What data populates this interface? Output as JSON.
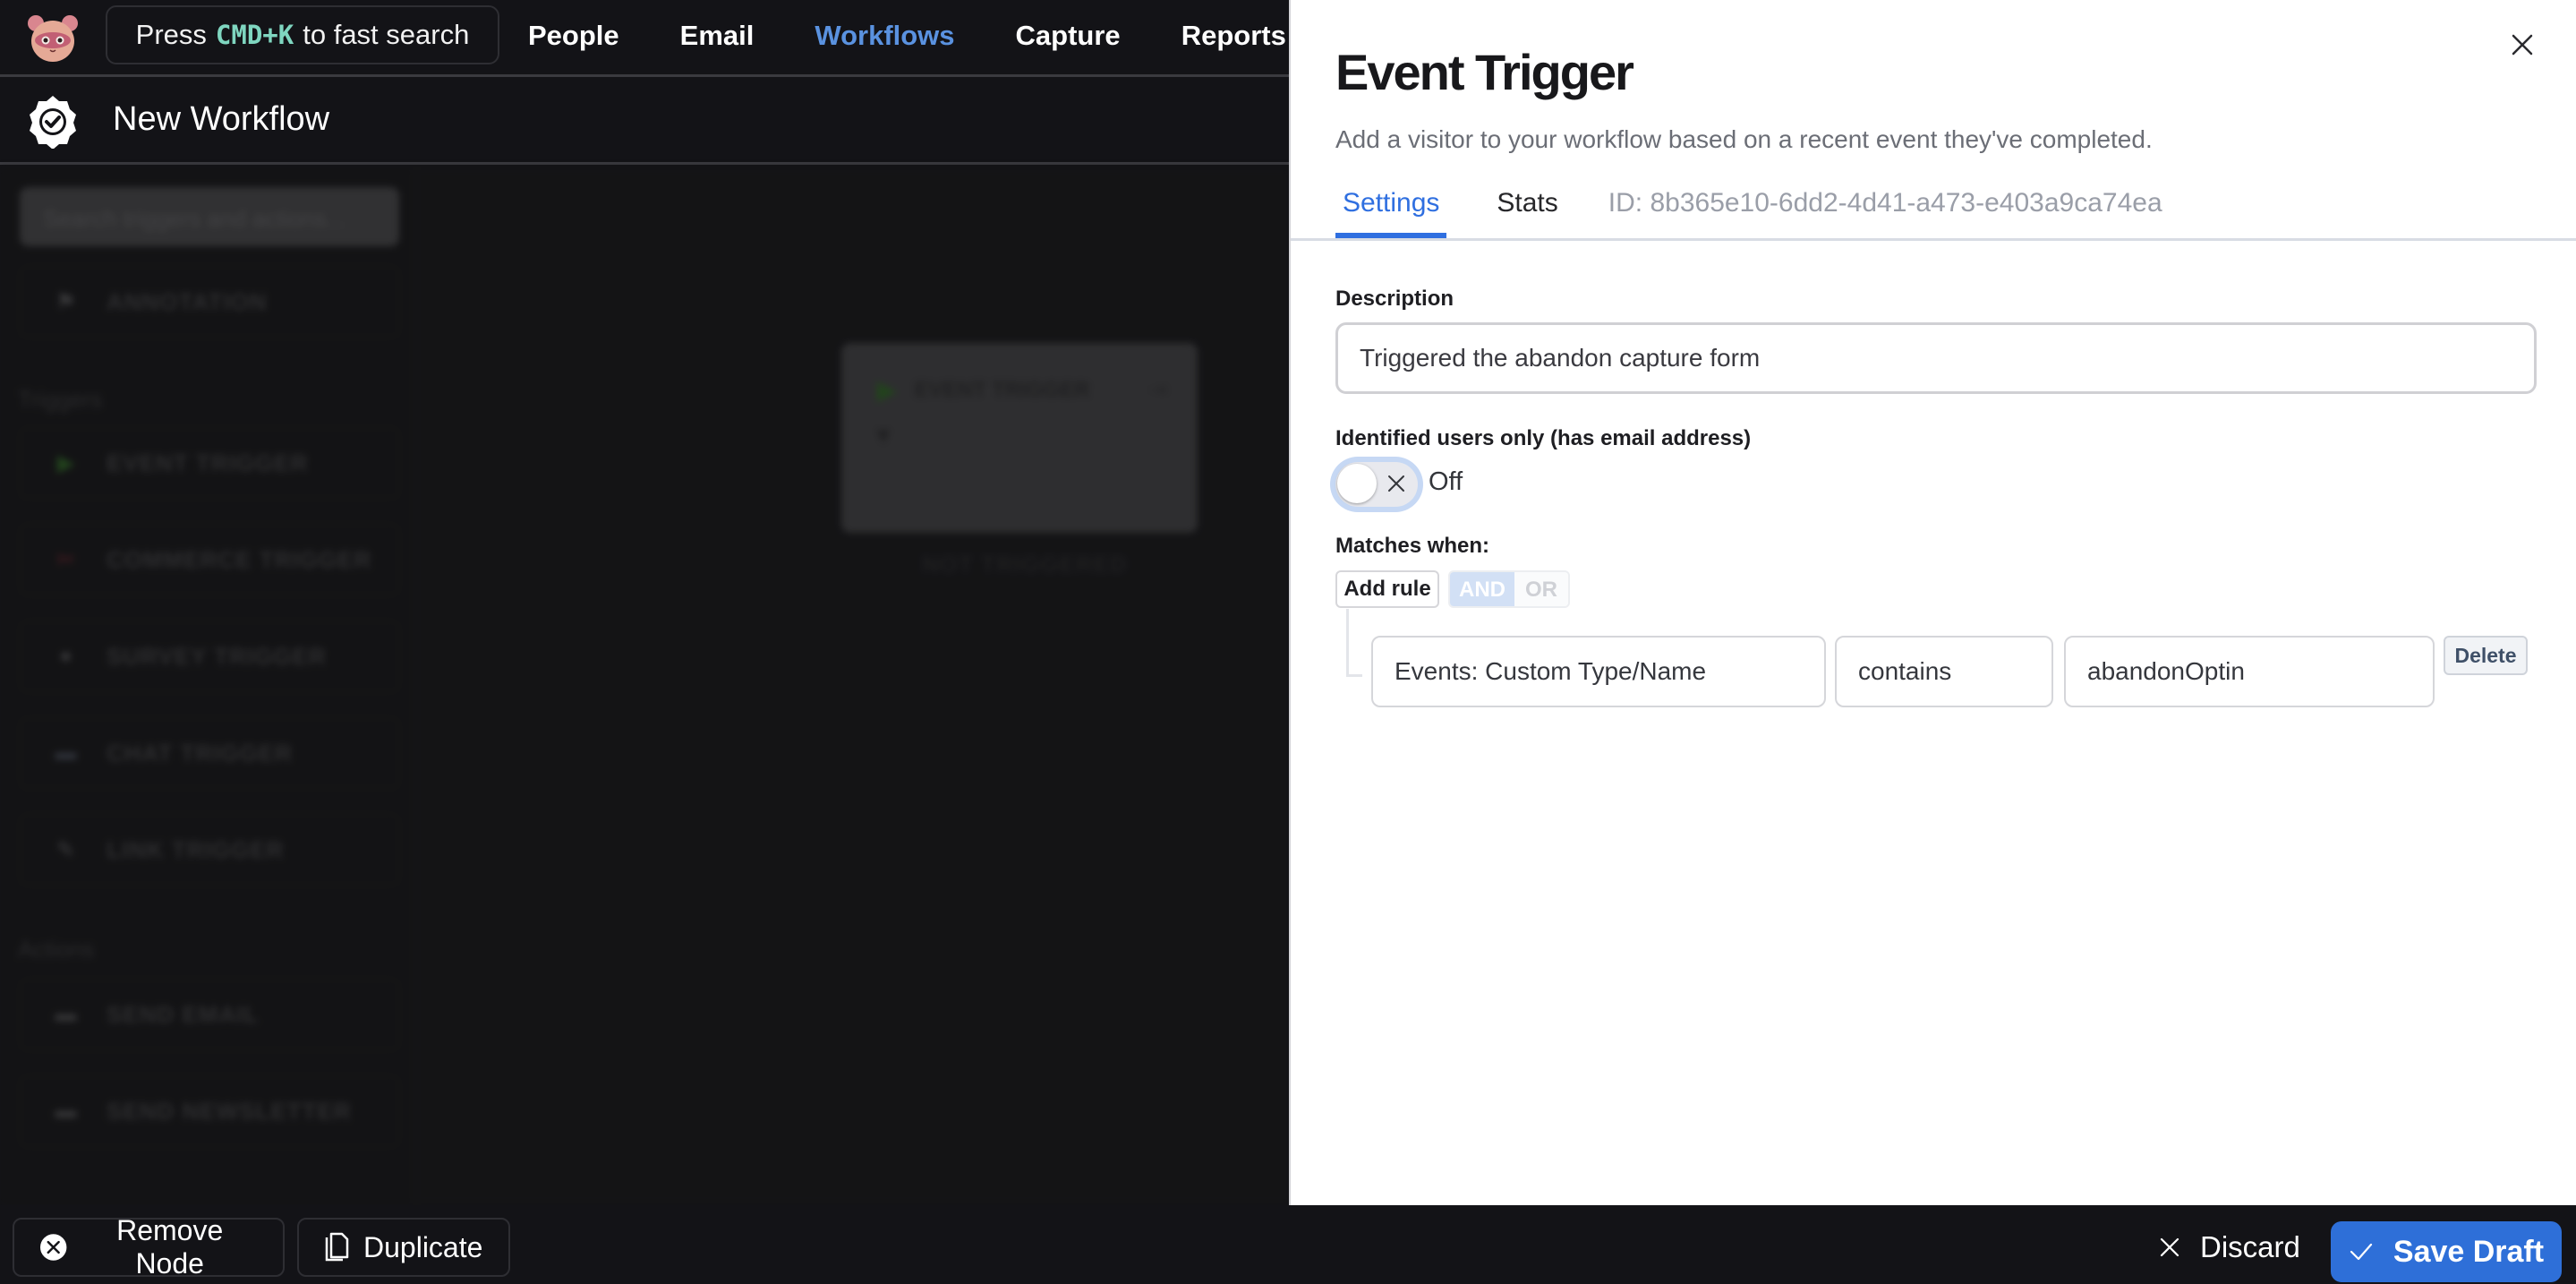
{
  "topnav": {
    "search_prefix": "Press",
    "search_shortcut": "CMD+K",
    "search_suffix": "to fast search",
    "items": [
      {
        "label": "People",
        "active": false
      },
      {
        "label": "Email",
        "active": false
      },
      {
        "label": "Workflows",
        "active": true
      },
      {
        "label": "Capture",
        "active": false
      },
      {
        "label": "Reports",
        "active": false
      }
    ],
    "accent_color": "#5a92e0",
    "shortcut_color": "#7fd6c0"
  },
  "workflow": {
    "title": "New Workflow"
  },
  "sidebar": {
    "search_placeholder": "Search triggers and actions...",
    "annotation_item": {
      "label": "ANNOTATION",
      "icon": "flag-icon"
    },
    "triggers_heading": "Triggers",
    "triggers": [
      {
        "label": "EVENT TRIGGER",
        "icon": "play-icon"
      },
      {
        "label": "COMMERCE TRIGGER",
        "icon": "cart-icon"
      },
      {
        "label": "SURVEY TRIGGER",
        "icon": "person-icon"
      },
      {
        "label": "CHAT TRIGGER",
        "icon": "chat-icon"
      },
      {
        "label": "LINK TRIGGER",
        "icon": "link-icon"
      }
    ],
    "actions_heading": "Actions",
    "actions": [
      {
        "label": "SEND EMAIL",
        "icon": "email-icon"
      },
      {
        "label": "SEND NEWSLETTER",
        "icon": "newsletter-icon"
      }
    ]
  },
  "canvas": {
    "node": {
      "title": "EVENT TRIGGER",
      "exit_icon": "exit-icon",
      "filter_icon": "filter-icon",
      "status": "NOT TRIGGERED"
    }
  },
  "panel": {
    "title": "Event Trigger",
    "subtitle": "Add a visitor to your workflow based on a recent event they've completed.",
    "tabs": [
      {
        "label": "Settings",
        "active": true
      },
      {
        "label": "Stats",
        "active": false
      }
    ],
    "id_text": "ID: 8b365e10-6dd2-4d41-a473-e403a9ca74ea",
    "description": {
      "label": "Description",
      "value": "Triggered the abandon capture form"
    },
    "identified": {
      "label": "Identified users only (has email address)",
      "toggle_on": false,
      "toggle_text": "Off"
    },
    "matches": {
      "label": "Matches when:",
      "add_rule": "Add rule",
      "and_label": "AND",
      "or_label": "OR",
      "selected_operator": "AND",
      "rules": [
        {
          "field": "Events: Custom Type/Name",
          "operator": "contains",
          "value": "abandonOptin",
          "delete_label": "Delete"
        }
      ]
    }
  },
  "bottombar": {
    "remove_node": "Remove Node",
    "duplicate": "Duplicate",
    "discard": "Discard",
    "save_draft": "Save Draft",
    "save_color": "#2e6fd8"
  }
}
